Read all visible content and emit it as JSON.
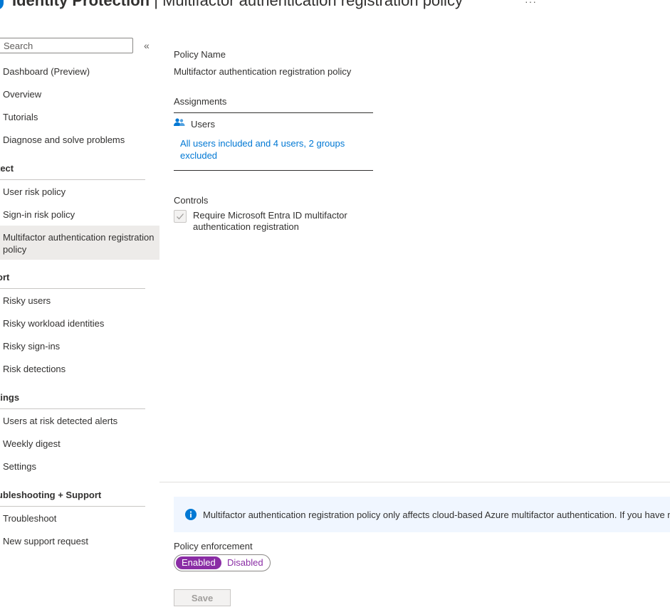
{
  "header": {
    "title_bold": "Identity Protection",
    "title_rest": " | Multifactor authentication registration policy",
    "more": "···"
  },
  "sidebar": {
    "search_placeholder": "Search",
    "collapse": "«",
    "items_top": [
      "Dashboard (Preview)",
      "Overview",
      "Tutorials",
      "Diagnose and solve problems"
    ],
    "sections": {
      "protect": "tect",
      "report": "ort",
      "settings": "tings",
      "troubleshooting": "ubleshooting + Support"
    },
    "protect_items": [
      "User risk policy",
      "Sign-in risk policy",
      "Multifactor authentication registration policy"
    ],
    "report_items": [
      "Risky users",
      "Risky workload identities",
      "Risky sign-ins",
      "Risk detections"
    ],
    "settings_items": [
      "Users at risk detected alerts",
      "Weekly digest",
      "Settings"
    ],
    "troubleshooting_items": [
      "Troubleshoot",
      "New support request"
    ]
  },
  "main": {
    "policy_name_label": "Policy Name",
    "policy_name_value": "Multifactor authentication registration policy",
    "assignments_label": "Assignments",
    "users_label": "Users",
    "users_link": "All users included and 4 users, 2 groups excluded",
    "controls_label": "Controls",
    "control_item": "Require Microsoft Entra ID multifactor authentication registration",
    "control_checked": true,
    "info_text": "Multifactor authentication registration policy only affects cloud-based Azure multifactor authentication. If you have multifact",
    "enforcement_label": "Policy enforcement",
    "enabled_label": "Enabled",
    "disabled_label": "Disabled",
    "enforcement_state": "Enabled",
    "save_label": "Save"
  },
  "colors": {
    "accent_purple": "#8a2da5",
    "link_blue": "#0078d4",
    "info_icon": "#0078d4",
    "info_bg": "#f0f6ff",
    "selected_bg": "#edebe9"
  },
  "icons": {
    "header": "shield-icon",
    "users": "users-group-icon",
    "info": "info-icon",
    "check": "checkmark-icon"
  }
}
